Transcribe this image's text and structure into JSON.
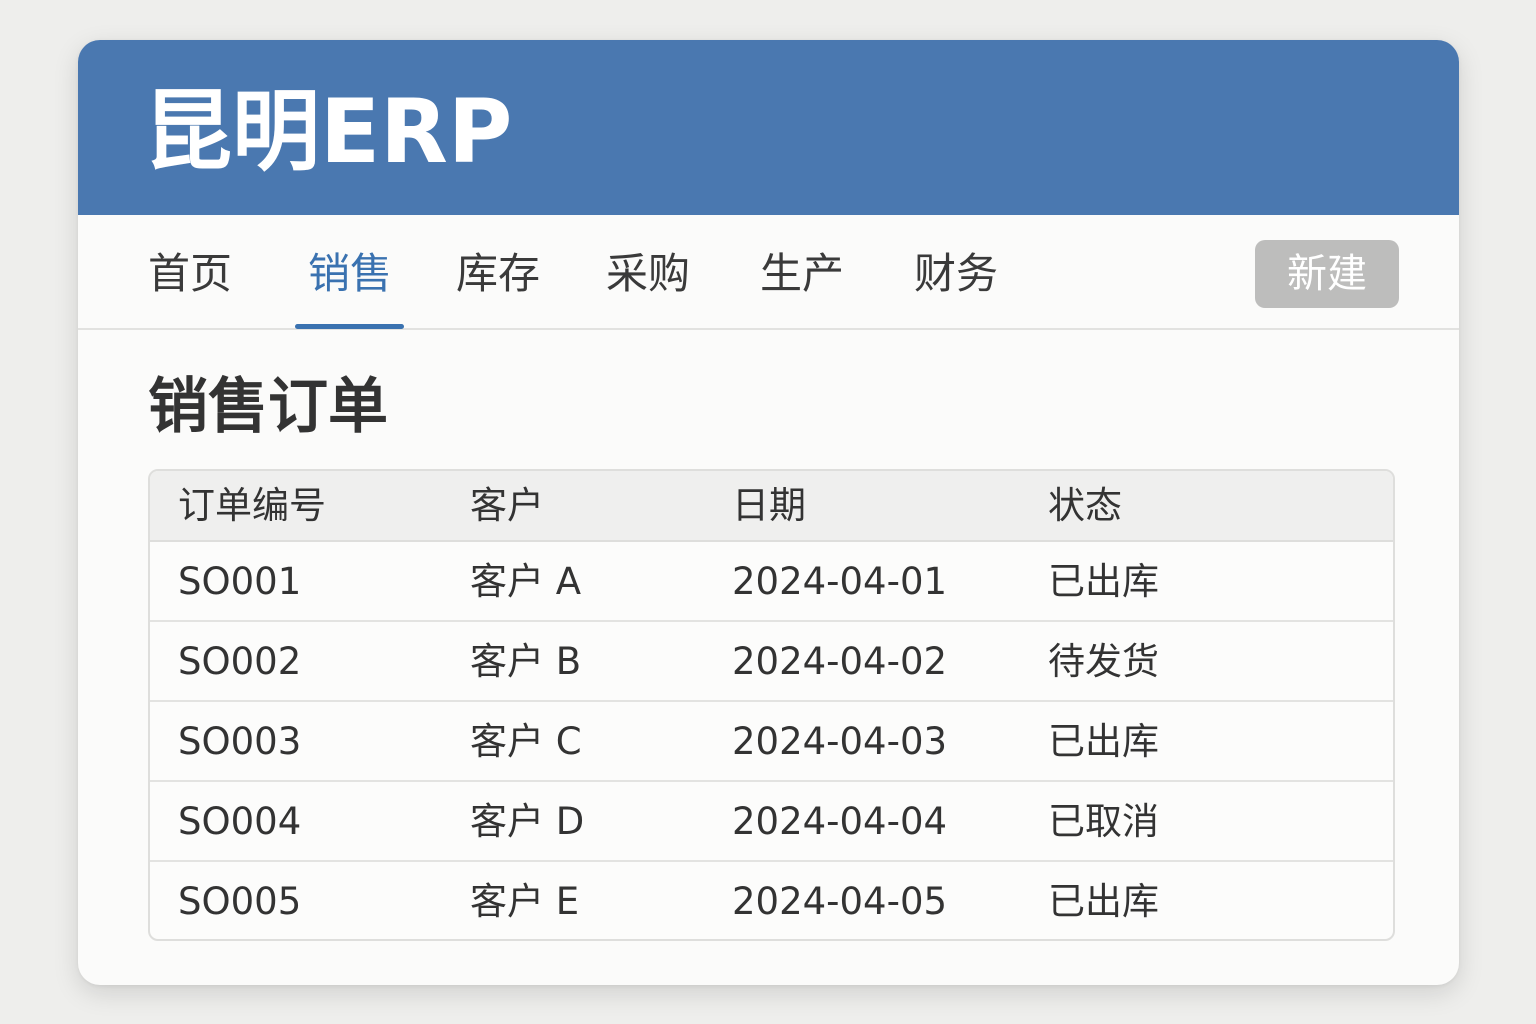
{
  "app": {
    "title": "昆明ERP",
    "brand_color": "#4a78b0",
    "accent_color": "#3a72b0"
  },
  "nav": {
    "tabs": [
      {
        "label": "首页",
        "active": false
      },
      {
        "label": "销售",
        "active": true
      },
      {
        "label": "库存",
        "active": false
      },
      {
        "label": "采购",
        "active": false
      },
      {
        "label": "生产",
        "active": false
      },
      {
        "label": "财务",
        "active": false
      }
    ],
    "new_button_label": "新建"
  },
  "main": {
    "page_title": "销售订单",
    "table": {
      "headers": [
        "订单编号",
        "客户",
        "日期",
        "状态"
      ],
      "rows": [
        [
          "SO001",
          "客户 A",
          "2024-04-01",
          "已出库"
        ],
        [
          "SO002",
          "客户 B",
          "2024-04-02",
          "待发货"
        ],
        [
          "SO003",
          "客户 C",
          "2024-04-03",
          "已出库"
        ],
        [
          "SO004",
          "客户 D",
          "2024-04-04",
          "已取消"
        ],
        [
          "SO005",
          "客户 E",
          "2024-04-05",
          "已出库"
        ]
      ]
    }
  }
}
